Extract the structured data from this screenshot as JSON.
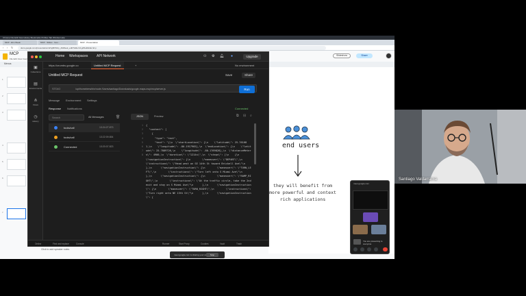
{
  "browser": {
    "os_bar_text": "Chrome  File  Edit  View  History  Bookmarks  Profiles  Tab  Window  Help",
    "tabs": [
      {
        "label": "MCP - Elm Week"
      },
      {
        "label": "MCP - Slides - Goo..."
      },
      {
        "label": "MCP - Presentation"
      }
    ],
    "url": "docs.google.com/presentation/d/1g8rhMcp_AltWeek_edit?slide=id.g2f1a#slide=id.p"
  },
  "slides": {
    "title": "MCP",
    "menu": "File  Edit  View  Insert  Format  Slide  Arrange  Tools  Extensions  Help",
    "toolbar_text": "Menus",
    "slideshow_label": "Slideshow",
    "share_label": "Share",
    "thumbnail_numbers": [
      "1",
      "2",
      "3",
      "4",
      "5",
      "6",
      "7"
    ],
    "notes_placeholder": "Click to add speaker notes",
    "canvas": {
      "end_users_label": "end users",
      "benefit_text": "they will benefit from more powerful and context rich applications"
    }
  },
  "postman": {
    "nav": {
      "home": "Home",
      "workspaces": "Workspaces",
      "api_network": "API Network",
      "upgrade": "Upgrade"
    },
    "sidebar": [
      {
        "label": "Collections",
        "icon": "folder-icon"
      },
      {
        "label": "Environments",
        "icon": "environment-icon"
      },
      {
        "label": "Flows",
        "icon": "flows-icon"
      },
      {
        "label": "History",
        "icon": "history-icon"
      }
    ],
    "tabs": [
      {
        "label": "https://crumbs.google.co"
      },
      {
        "label": "Untitled MCP Request"
      }
    ],
    "env_selector": "No environment",
    "request_title": "Untitled MCP Request",
    "save_label": "Save",
    "share_label": "Share",
    "method": "STDIO",
    "url": "/opt/homebrew/bin/node /Users/santiago/Downloads/google-maps-mcp/mcp/server.js",
    "run_label": "Run",
    "subtabs_top": [
      "Message",
      "Environment",
      "Settings"
    ],
    "subtabs_bottom": [
      "Response",
      "Notifications"
    ],
    "connection_status": "Connected",
    "search_placeholder": "Search",
    "filter_label": "All Messages",
    "view_json": "JSON",
    "view_preview": "Preview",
    "messages": [
      {
        "name": "tools/call",
        "time": "13:24:27.873",
        "color": "#3b82f6"
      },
      {
        "name": "tools/call",
        "time": "13:22:09.654",
        "color": "#f0a020"
      },
      {
        "name": "Connected",
        "time": "13:20:07.823",
        "color": "#6bc46b"
      }
    ],
    "gutter": "1\n2\n3\n4\n5\n6\n7\n8",
    "code": "{\n  \"content\": [\n    {\n      \"type\": \"text\",\n      \"text\": \"{\\n  \\\"startLocation\\\": {\\n    \\\"latitude\\\": 25.761681,\\n    \\\"longitude\\\": -80.1917902},\\n  \\\"endLocation\\\": {\\n    \\\"latitude\\\": 25.7889726,\\n    \\\"longitude\\\": -80.1769828},\\n  \\\"distanceMeters\\\": 4900,\\n  \\\"duration\\\": \\\"1214s\\\",\\n  \\\"steps\\\": [\\n    {\\n      \\\"navigationInstruction\\\": {\\n        \\\"maneuver\\\": \\\"DEPART\\\",\\n        \\\"instructions\\\": \\\"Head west on SE 14th St toward Brickell Ave\\\"\\n      },\\n      \\\"navigationInstruction\\\": {\\n        \\\"maneuver\\\": \\\"TURN_LEFT\\\",\\n        \\\"instructions\\\": \\\"Turn left onto S Miami Ave\\\"\\n      },\\n      \\\"navigationInstruction\\\": {\\n        \\\"maneuver\\\": \\\"RAMP_RIGHT\\\",\\n        \\\"instructions\\\": \\\"At the traffic circle, take the 2nd exit and stay on S Miami Ave\\\"\\n      },\\n      \\\"navigationInstruction\\\": {\\n        \\\"maneuver\\\": \\\"TURN_RIGHT\\\",\\n        \\\"instructions\\\": \\\"Turn right onto NE 13th St\\\"\\n      },\\n      \\\"navigationInstruction\\\": {",
    "bottom_bar": [
      "Online",
      "Find and replace",
      "Console",
      "Runner",
      "Start Proxy",
      "Cookies",
      "Vault",
      "Trash"
    ]
  },
  "meet": {
    "share_bar_text": "meet.google.com is sharing your screen",
    "stop_label": "Stop",
    "mini_title": "meet.google.com",
    "mini_share_text": "You are presenting to everyone"
  },
  "camera": {
    "presenter_name": "Santiago Valdarrama"
  },
  "colors": {
    "postman_bg": "#1d1d1d",
    "run_button": "#0f6fd6",
    "share_button": "#c2e7ff",
    "end_call": "#ea4335"
  }
}
